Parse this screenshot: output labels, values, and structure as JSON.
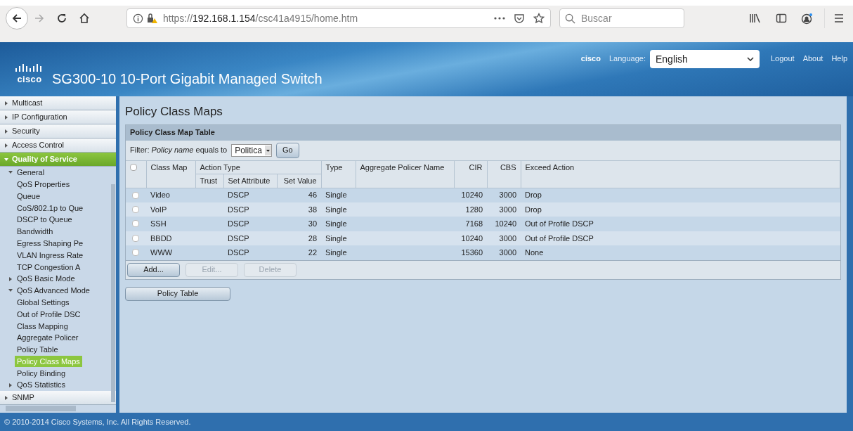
{
  "browser": {
    "url_prefix": "https://",
    "url_host": "192.168.1.154",
    "url_path": "/csc41a4915/home.htm",
    "search_placeholder": "Buscar"
  },
  "header": {
    "brand": "cisco",
    "title": "SG300-10 10-Port Gigabit Managed Switch",
    "user": "cisco",
    "language_label": "Language:",
    "language_value": "English",
    "links": [
      "Logout",
      "About",
      "Help"
    ]
  },
  "sidebar": {
    "items": [
      {
        "label": "Multicast",
        "expanded": false,
        "selected": false
      },
      {
        "label": "IP Configuration",
        "expanded": false,
        "selected": false
      },
      {
        "label": "Security",
        "expanded": false,
        "selected": false
      },
      {
        "label": "Access Control",
        "expanded": false,
        "selected": false
      },
      {
        "label": "Quality of Service",
        "expanded": true,
        "selected": true,
        "children": [
          {
            "label": "General",
            "expanded": true,
            "selected": false,
            "children": [
              {
                "label": "QoS Properties",
                "selected": false
              },
              {
                "label": "Queue",
                "selected": false
              },
              {
                "label": "CoS/802.1p to Que",
                "selected": false
              },
              {
                "label": "DSCP to Queue",
                "selected": false
              },
              {
                "label": "Bandwidth",
                "selected": false
              },
              {
                "label": "Egress Shaping Pe",
                "selected": false
              },
              {
                "label": "VLAN Ingress Rate",
                "selected": false
              },
              {
                "label": "TCP Congestion A",
                "selected": false
              }
            ]
          },
          {
            "label": "QoS Basic Mode",
            "expanded": false,
            "selected": false
          },
          {
            "label": "QoS Advanced Mode",
            "expanded": true,
            "selected": false,
            "children": [
              {
                "label": "Global Settings",
                "selected": false
              },
              {
                "label": "Out of Profile DSC",
                "selected": false
              },
              {
                "label": "Class Mapping",
                "selected": false
              },
              {
                "label": "Aggregate Policer",
                "selected": false
              },
              {
                "label": "Policy Table",
                "selected": false
              },
              {
                "label": "Policy Class Maps",
                "selected": true
              },
              {
                "label": "Policy Binding",
                "selected": false
              }
            ]
          },
          {
            "label": "QoS Statistics",
            "expanded": false,
            "selected": false
          }
        ]
      },
      {
        "label": "SNMP",
        "expanded": false,
        "selected": false
      }
    ]
  },
  "page": {
    "title": "Policy Class Maps",
    "table_title": "Policy Class Map Table",
    "filter": {
      "label": "Filter:",
      "field": "Policy name",
      "operator": "equals to",
      "value": "Politica",
      "button": "Go"
    },
    "select_all_checked": false,
    "columns": [
      {
        "label": "Class Map",
        "kind": "text"
      },
      {
        "label": "Action Type",
        "colspan": 3,
        "children": [
          {
            "label": "Trust",
            "kind": "text"
          },
          {
            "label": "Set Attribute",
            "kind": "text"
          },
          {
            "label": "Set Value",
            "kind": "number"
          }
        ]
      },
      {
        "label": "Type",
        "kind": "text"
      },
      {
        "label": "Aggregate Policer Name",
        "kind": "text"
      },
      {
        "label": "CIR",
        "kind": "number"
      },
      {
        "label": "CBS",
        "kind": "number"
      },
      {
        "label": "Exceed Action",
        "kind": "text"
      }
    ],
    "rows": [
      {
        "checked": false,
        "cells": [
          "Video",
          "",
          "DSCP",
          "46",
          "Single",
          "",
          "10240",
          "3000",
          "Drop"
        ]
      },
      {
        "checked": false,
        "cells": [
          "VoIP",
          "",
          "DSCP",
          "38",
          "Single",
          "",
          "1280",
          "3000",
          "Drop"
        ]
      },
      {
        "checked": false,
        "cells": [
          "SSH",
          "",
          "DSCP",
          "30",
          "Single",
          "",
          "7168",
          "10240",
          "Out of Profile DSCP"
        ]
      },
      {
        "checked": false,
        "cells": [
          "BBDD",
          "",
          "DSCP",
          "28",
          "Single",
          "",
          "10240",
          "3000",
          "Out of Profile DSCP"
        ]
      },
      {
        "checked": false,
        "cells": [
          "WWW",
          "",
          "DSCP",
          "22",
          "Single",
          "",
          "15360",
          "3000",
          "None"
        ]
      }
    ],
    "actions": [
      {
        "label": "Add...",
        "disabled": false
      },
      {
        "label": "Edit...",
        "disabled": true
      },
      {
        "label": "Delete",
        "disabled": true
      }
    ],
    "bottom_button": "Policy Table"
  },
  "footer": "© 2010-2014 Cisco Systems, Inc. All Rights Reserved."
}
